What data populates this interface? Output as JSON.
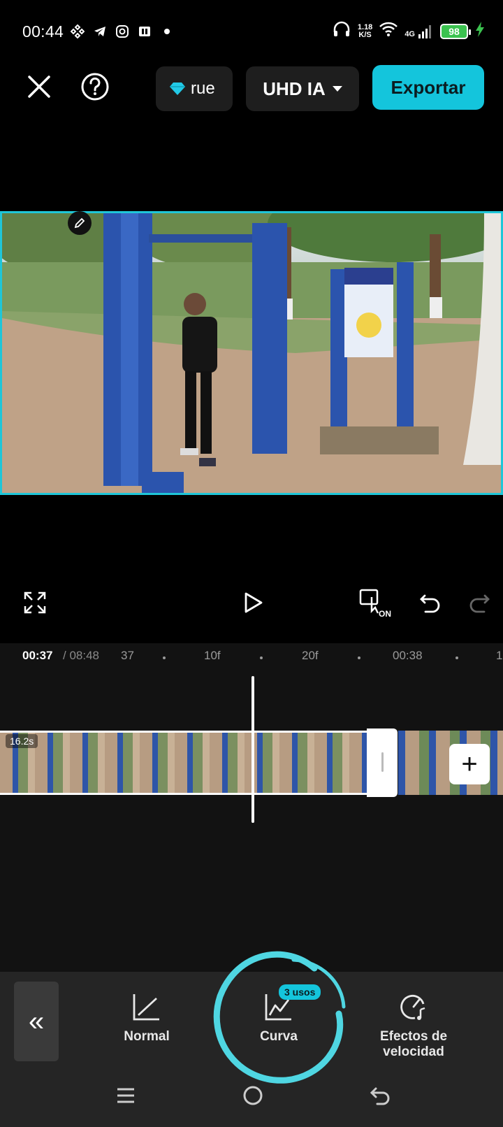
{
  "status_bar": {
    "time": "00:44",
    "net_speed_top": "1.18",
    "net_speed_unit": "K/S",
    "network": "4G",
    "battery": "98"
  },
  "toolbar": {
    "pro_label": "rue",
    "quality_label": "UHD IA",
    "export_label": "Exportar"
  },
  "timeline": {
    "current_time": "00:37",
    "total_time": "/ 08:48",
    "ticks": [
      "37",
      "10f",
      "20f",
      "00:38",
      "1"
    ],
    "clip_duration": "16.2s"
  },
  "bottom_tools": {
    "normal_label": "Normal",
    "curve_label": "Curva",
    "curve_badge": "3 usos",
    "speed_label_1": "Efectos de",
    "speed_label_2": "velocidad"
  },
  "colors": {
    "accent": "#14c5dc",
    "background": "#000000",
    "panel": "#252525"
  }
}
